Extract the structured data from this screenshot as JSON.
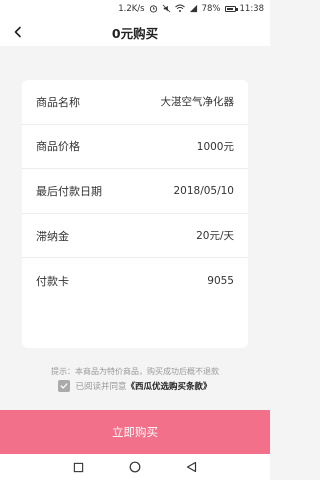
{
  "status_bar": {
    "speed": "1.2K/s",
    "battery": "78%",
    "time": "11:38"
  },
  "header": {
    "title": "0元购买"
  },
  "details": {
    "rows": [
      {
        "label": "商品名称",
        "value": "大湛空气净化器"
      },
      {
        "label": "商品价格",
        "value": "1000元"
      },
      {
        "label": "最后付款日期",
        "value": "2018/05/10"
      },
      {
        "label": "滞纳金",
        "value": "20元/天"
      },
      {
        "label": "付款卡",
        "value": "9055"
      }
    ]
  },
  "hint": "提示：本商品为特价商品，购买成功后概不退款",
  "agreement": {
    "prefix": "已阅读并同意",
    "link": "《西瓜优选购买条款》",
    "checked": true
  },
  "buy_button": "立即购买",
  "colors": {
    "accent": "#f2708a",
    "background": "#f4f4f4"
  }
}
